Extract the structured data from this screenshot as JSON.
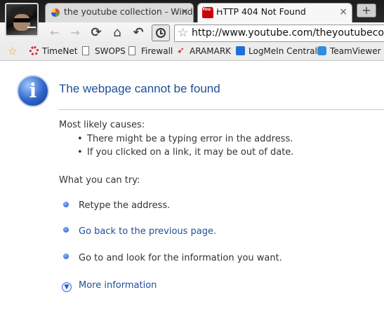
{
  "window": {
    "tabs": [
      {
        "title": "the youtube collection - Wind...",
        "active": false,
        "favicon": "pinwheel-icon"
      },
      {
        "title": "HTTP 404 Not Found",
        "active": true,
        "favicon": "youtube-icon",
        "favicon_text": "You Tube"
      }
    ],
    "close_glyph": "×",
    "new_tab_glyph": "+"
  },
  "toolbar": {
    "back": "←",
    "forward": "→",
    "reload": "⟳",
    "home": "⌂",
    "undo": "↶",
    "url": "http://www.youtube.com/theyoutubecollection"
  },
  "bookmarks": [
    {
      "label": "TimeNet",
      "icon": "timenet-icon"
    },
    {
      "label": "SWOPS",
      "icon": "page-icon"
    },
    {
      "label": "Firewall",
      "icon": "page-icon"
    },
    {
      "label": "ARAMARK",
      "icon": "aramark-icon"
    },
    {
      "label": "LogMeIn Central",
      "icon": "logmein-icon"
    },
    {
      "label": "TeamViewer",
      "icon": "teamviewer-icon"
    }
  ],
  "error": {
    "info_glyph": "i",
    "heading": "The webpage cannot be found",
    "causes_title": "Most likely causes:",
    "causes": [
      "There might be a typing error in the address.",
      "If you clicked on a link, it may be out of date."
    ],
    "try_title": "What you can try:",
    "actions": [
      {
        "text": "Retype the address.",
        "link": false
      },
      {
        "text": "Go back to the previous page.",
        "link": true
      },
      {
        "text": "Go to  and look for the information you want.",
        "link": false
      }
    ],
    "more_info": "More information"
  },
  "colors": {
    "heading": "#1f4e9a",
    "link": "#1f4e9a",
    "chrome_dark": "#1b1b1b"
  }
}
